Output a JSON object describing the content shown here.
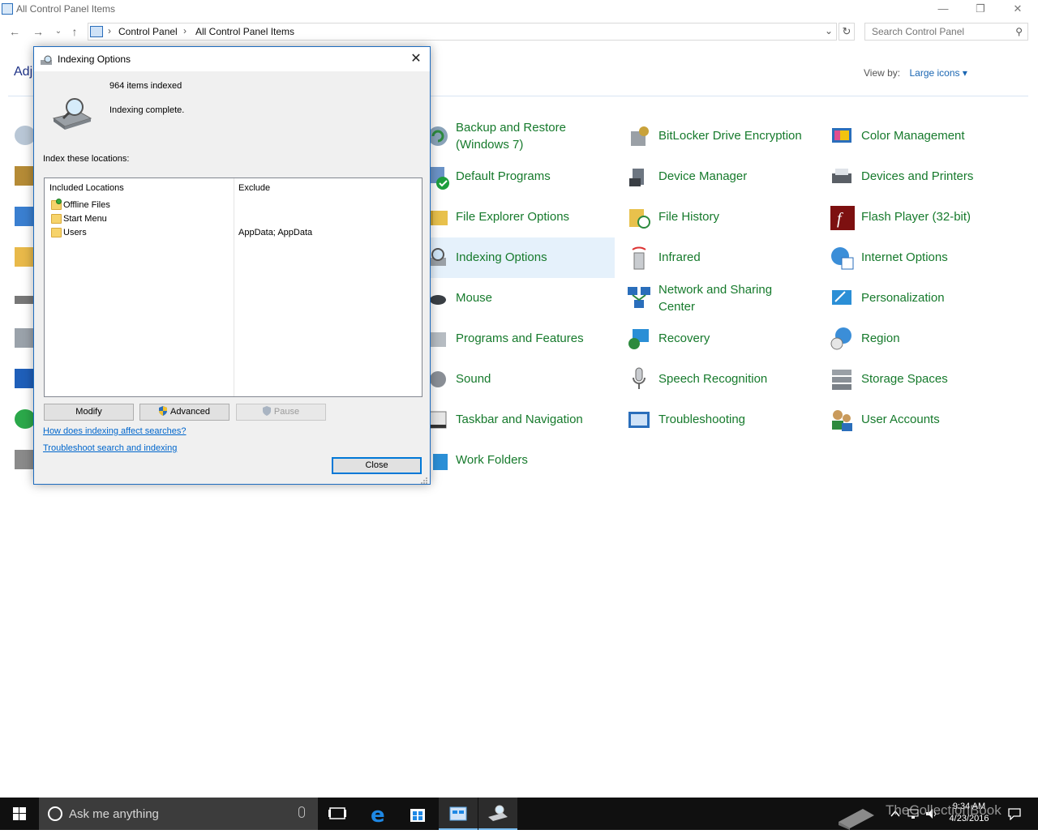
{
  "window": {
    "title": "All Control Panel Items",
    "minimize": "—",
    "restore": "❐",
    "close": "✕"
  },
  "address": {
    "crumbs": [
      "Control Panel",
      "All Control Panel Items"
    ],
    "search_placeholder": "Search Control Panel"
  },
  "heading": "Adj",
  "view_by": {
    "label": "View by:",
    "value": "Large icons ▾"
  },
  "items": [
    {
      "label": "Backup and Restore (Windows 7)",
      "icon": "backup-icon"
    },
    {
      "label": "BitLocker Drive Encryption",
      "icon": "bitlocker-icon"
    },
    {
      "label": "Color Management",
      "icon": "color-management-icon"
    },
    {
      "label": "Default Programs",
      "icon": "default-programs-icon"
    },
    {
      "label": "Device Manager",
      "icon": "device-manager-icon"
    },
    {
      "label": "Devices and Printers",
      "icon": "printer-icon"
    },
    {
      "label": "File Explorer Options",
      "icon": "folder-options-icon"
    },
    {
      "label": "File History",
      "icon": "file-history-icon"
    },
    {
      "label": "Flash Player (32-bit)",
      "icon": "flash-icon"
    },
    {
      "label": "Indexing Options",
      "icon": "indexing-icon"
    },
    {
      "label": "Infrared",
      "icon": "infrared-icon"
    },
    {
      "label": "Internet Options",
      "icon": "internet-options-icon"
    },
    {
      "label": "Mouse",
      "icon": "mouse-icon"
    },
    {
      "label": "Network and Sharing Center",
      "icon": "network-icon"
    },
    {
      "label": "Personalization",
      "icon": "personalization-icon"
    },
    {
      "label": "Programs and Features",
      "icon": "programs-icon"
    },
    {
      "label": "Recovery",
      "icon": "recovery-icon"
    },
    {
      "label": "Region",
      "icon": "region-icon"
    },
    {
      "label": "Sound",
      "icon": "sound-icon"
    },
    {
      "label": "Speech Recognition",
      "icon": "microphone-icon"
    },
    {
      "label": "Storage Spaces",
      "icon": "storage-icon"
    },
    {
      "label": "Taskbar and Navigation",
      "icon": "taskbar-icon"
    },
    {
      "label": "Troubleshooting",
      "icon": "troubleshooting-icon"
    },
    {
      "label": "User Accounts",
      "icon": "users-icon"
    },
    {
      "label": "Work Folders",
      "icon": "work-folders-icon"
    }
  ],
  "dialog": {
    "title": "Indexing Options",
    "items_indexed": "964 items indexed",
    "status": "Indexing complete.",
    "index_label": "Index these locations:",
    "col_included": "Included Locations",
    "col_exclude": "Exclude",
    "locations": [
      {
        "name": "Offline Files",
        "exclude": ""
      },
      {
        "name": "Start Menu",
        "exclude": ""
      },
      {
        "name": "Users",
        "exclude": "AppData; AppData"
      }
    ],
    "modify": "Modify",
    "advanced": "Advanced",
    "pause": "Pause",
    "link_affect": "How does indexing affect searches?",
    "link_troubleshoot": "Troubleshoot search and indexing",
    "close": "Close"
  },
  "taskbar": {
    "search_placeholder": "Ask me anything",
    "time": "9:34 AM",
    "date": "4/23/2016"
  },
  "watermark": "TheCollectionBook"
}
